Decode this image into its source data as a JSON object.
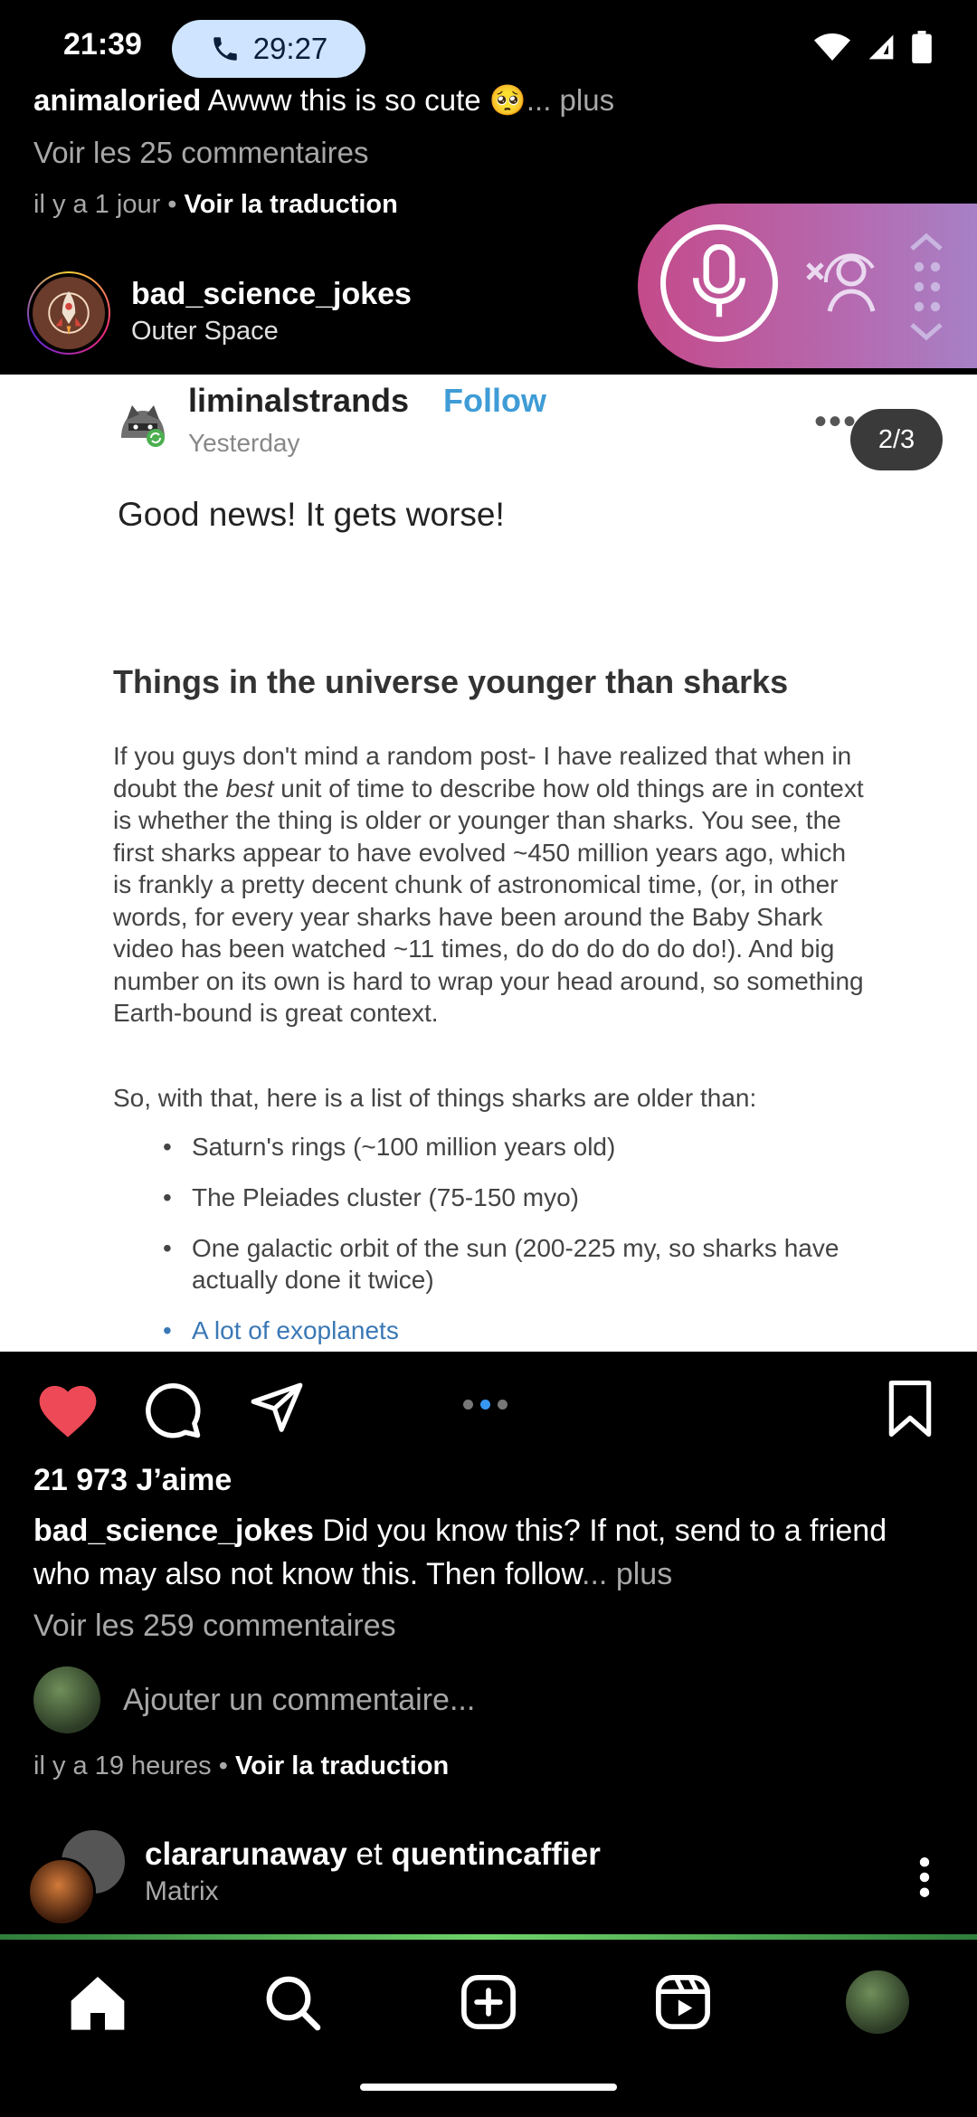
{
  "status_bar": {
    "time": "21:39",
    "call_duration": "29:27"
  },
  "previous_post": {
    "comment_user": "animaloried",
    "comment_text": "Awww this is so cute 🥺",
    "comment_more": "... plus",
    "view_comments": "Voir les 25 commentaires",
    "time_ago": "il y a 1 jour",
    "translate": "Voir la traduction"
  },
  "post": {
    "username": "bad_science_jokes",
    "location": "Outer Space",
    "image": {
      "inner_username": "liminalstrands",
      "follow": "Follow",
      "date": "Yesterday",
      "counter": "2/3",
      "headline": "Good news! It gets worse!",
      "article_title": "Things in the universe younger than sharks",
      "article_body_before": "If you guys don't mind a random post- I have realized that when in doubt the ",
      "article_body_em": "best",
      "article_body_after": " unit of time to describe how old things are in context is whether the thing is older or younger than sharks. You see, the first sharks appear to have evolved ~450 million years ago, which is frankly a pretty decent chunk of astronomical time, (or, in other words, for every year sharks have been around the Baby Shark video has been watched ~11 times, do do do do do do!). And big number on its own is hard to wrap your head around, so something Earth-bound is great context.",
      "list_lead": "So, with that, here is a list of things sharks are older than:",
      "list_items": [
        "Saturn's rings (~100 million years old)",
        "The Pleiades cluster (75-150 myo)",
        "One galactic orbit of the sun (200-225 my, so sharks have actually done it twice)",
        "A lot of exoplanets"
      ]
    },
    "likes": "21 973 J’aime",
    "caption_user": "bad_science_jokes",
    "caption_text": "Did you know this? If not, send to a friend who may also not know this. Then follow",
    "caption_more": "... plus",
    "view_comments": "Voir les 259 commentaires",
    "comment_placeholder": "Ajouter un commentaire...",
    "time_ago": "il y a 19 heures",
    "translate": "Voir la traduction"
  },
  "next_post": {
    "user1": "clararunaway",
    "conjunction": "et",
    "user2": "quentincaffier",
    "subtitle": "Matrix"
  },
  "colors": {
    "like_red": "#ed4956",
    "accent_blue": "#3897f0",
    "follow_blue": "#3f9cd6"
  },
  "icons": {
    "like": "heart-icon",
    "comment": "comment-icon",
    "share": "send-icon",
    "save": "bookmark-icon",
    "nav": [
      "home-icon",
      "search-icon",
      "create-icon",
      "reels-icon",
      "profile-avatar"
    ]
  }
}
